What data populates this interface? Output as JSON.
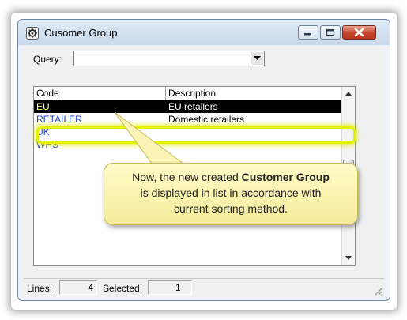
{
  "window": {
    "title": "Cusomer Group",
    "icon": "gear-icon",
    "controls": [
      "minimize-icon",
      "maximize-icon",
      "close-icon"
    ]
  },
  "query": {
    "label": "Query:",
    "value": ""
  },
  "grid": {
    "columns": [
      "Code",
      "Description"
    ],
    "rows": [
      {
        "code": "EU",
        "description": "EU retailers",
        "selected": true
      },
      {
        "code": "RETAILER",
        "description": "Domestic retailers",
        "selected": false
      },
      {
        "code": "UK",
        "description": "",
        "selected": false
      },
      {
        "code": "WHS",
        "description": "",
        "selected": false
      }
    ]
  },
  "callout": {
    "line1_before": "Now, the new created ",
    "line1_bold": "Customer Group",
    "line2": "is displayed in list in accordance with",
    "line3": "current sorting method."
  },
  "status": {
    "lines_label": "Lines:",
    "lines_value": "4",
    "selected_label": "Selected:",
    "selected_value": "1"
  },
  "colors": {
    "selection_bg": "#000000",
    "selection_code": "#ffff66",
    "code_text": "#1f3fc8",
    "highlight": "#e4f200",
    "close_button": "#c9452c"
  }
}
